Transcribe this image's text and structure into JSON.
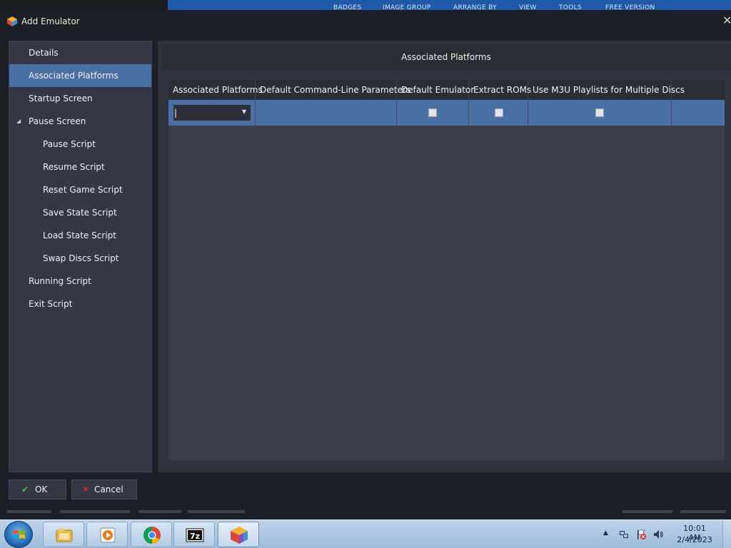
{
  "background_app": {
    "menu": [
      "BADGES",
      "IMAGE GROUP",
      "ARRANGE BY",
      "VIEW",
      "TOOLS",
      "FREE VERSION"
    ]
  },
  "dialog": {
    "title": "Add Emulator",
    "close_glyph": "✕"
  },
  "nav": {
    "items": [
      {
        "label": "Details",
        "level": 0
      },
      {
        "label": "Associated Platforms",
        "level": 0,
        "selected": true
      },
      {
        "label": "Startup Screen",
        "level": 0
      },
      {
        "label": "Pause Screen",
        "level": 0,
        "expanded": true
      },
      {
        "label": "Pause Script",
        "level": 1
      },
      {
        "label": "Resume Script",
        "level": 1
      },
      {
        "label": "Reset Game Script",
        "level": 1
      },
      {
        "label": "Save State Script",
        "level": 1
      },
      {
        "label": "Load State Script",
        "level": 1
      },
      {
        "label": "Swap Discs Script",
        "level": 1
      },
      {
        "label": "Running Script",
        "level": 0
      },
      {
        "label": "Exit Script",
        "level": 0
      }
    ]
  },
  "main": {
    "header": "Associated Platforms",
    "grid": {
      "columns": [
        "Associated Platforms",
        "Default Command-Line Parameters",
        "Default Emulator",
        "Extract ROMs",
        "Use M3U Playlists for Multiple Discs"
      ],
      "rows": [
        {
          "platform": "",
          "command_line": "",
          "default_emulator": false,
          "extract_roms": false,
          "use_m3u": false
        }
      ]
    }
  },
  "footer": {
    "ok_label": "OK",
    "cancel_label": "Cancel"
  },
  "taskbar": {
    "pinned": [
      "windows-explorer",
      "media-player",
      "chrome",
      "7zip",
      "launchbox"
    ],
    "clock_time": "10:01 AM",
    "clock_date": "2/4/2023"
  },
  "colors": {
    "selection": "#4a6fa5",
    "panel": "#343844",
    "dialog_bg": "#1c1f25",
    "ok_icon": "#3cc45a",
    "cancel_icon": "#e0322e"
  }
}
